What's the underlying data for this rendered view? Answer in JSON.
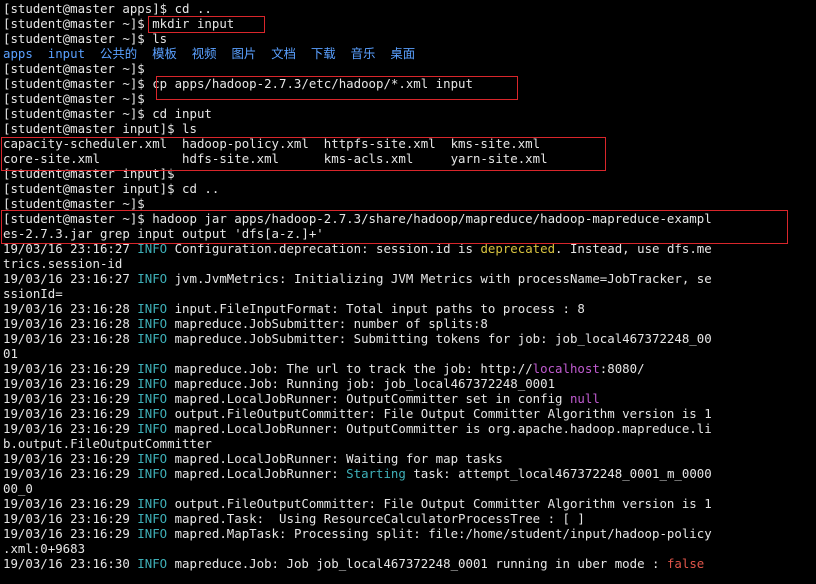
{
  "terminal": {
    "lines": [
      [
        [
          "[student@master apps]$ cd ..",
          ""
        ]
      ],
      [
        [
          "[student@master ~]$ mkdir input",
          ""
        ]
      ],
      [
        [
          "[student@master ~]$ ls",
          ""
        ]
      ],
      [
        [
          "apps",
          "blue"
        ],
        [
          "  ",
          ""
        ],
        [
          "input",
          "blue"
        ],
        [
          "  ",
          ""
        ],
        [
          "公共的",
          "blue"
        ],
        [
          "  ",
          ""
        ],
        [
          "模板",
          "blue"
        ],
        [
          "  ",
          ""
        ],
        [
          "视频",
          "blue"
        ],
        [
          "  ",
          ""
        ],
        [
          "图片",
          "blue"
        ],
        [
          "  ",
          ""
        ],
        [
          "文档",
          "blue"
        ],
        [
          "  ",
          ""
        ],
        [
          "下载",
          "blue"
        ],
        [
          "  ",
          ""
        ],
        [
          "音乐",
          "blue"
        ],
        [
          "  ",
          ""
        ],
        [
          "桌面",
          "blue"
        ]
      ],
      [
        [
          "[student@master ~]$",
          ""
        ]
      ],
      [
        [
          "[student@master ~]$ cp apps/hadoop-2.7.3/etc/hadoop/*.xml input",
          ""
        ]
      ],
      [
        [
          "[student@master ~]$",
          ""
        ]
      ],
      [
        [
          "[student@master ~]$ cd input",
          ""
        ]
      ],
      [
        [
          "[student@master input]$ ls",
          ""
        ]
      ],
      [
        [
          "capacity-scheduler.xml  hadoop-policy.xml  httpfs-site.xml  kms-site.xml",
          ""
        ]
      ],
      [
        [
          "core-site.xml           hdfs-site.xml      kms-acls.xml     yarn-site.xml",
          ""
        ]
      ],
      [
        [
          "[student@master input]$",
          ""
        ]
      ],
      [
        [
          "[student@master input]$ cd ..",
          ""
        ]
      ],
      [
        [
          "[student@master ~]$",
          ""
        ]
      ],
      [
        [
          "[student@master ~]$ hadoop jar apps/hadoop-2.7.3/share/hadoop/mapreduce/hadoop-mapreduce-exampl",
          ""
        ]
      ],
      [
        [
          "es-2.7.3.jar grep input output 'dfs[a-z.]+'",
          ""
        ]
      ],
      [
        [
          "19/03/16 23:16:27 ",
          ""
        ],
        [
          "INFO",
          "green"
        ],
        [
          " Configuration.deprecation: session.id is ",
          ""
        ],
        [
          "deprecated",
          "yellow"
        ],
        [
          ". Instead, use dfs.me",
          ""
        ]
      ],
      [
        [
          "trics.session-id",
          ""
        ]
      ],
      [
        [
          "19/03/16 23:16:27 ",
          ""
        ],
        [
          "INFO",
          "green"
        ],
        [
          " jvm.JvmMetrics: Initializing JVM Metrics with processName=JobTracker, se",
          ""
        ]
      ],
      [
        [
          "ssionId=",
          ""
        ]
      ],
      [
        [
          "19/03/16 23:16:28 ",
          ""
        ],
        [
          "INFO",
          "green"
        ],
        [
          " input.FileInputFormat: Total input paths to process : 8",
          ""
        ]
      ],
      [
        [
          "19/03/16 23:16:28 ",
          ""
        ],
        [
          "INFO",
          "green"
        ],
        [
          " mapreduce.JobSubmitter: number of splits:8",
          ""
        ]
      ],
      [
        [
          "19/03/16 23:16:28 ",
          ""
        ],
        [
          "INFO",
          "green"
        ],
        [
          " mapreduce.JobSubmitter: Submitting tokens for job: job_local467372248_00",
          ""
        ]
      ],
      [
        [
          "01",
          ""
        ]
      ],
      [
        [
          "19/03/16 23:16:29 ",
          ""
        ],
        [
          "INFO",
          "green"
        ],
        [
          " mapreduce.Job: The url to track the job: http://",
          ""
        ],
        [
          "localhost",
          "purple"
        ],
        [
          ":8080/",
          ""
        ]
      ],
      [
        [
          "19/03/16 23:16:29 ",
          ""
        ],
        [
          "INFO",
          "green"
        ],
        [
          " mapreduce.Job: Running job: job_local467372248_0001",
          ""
        ]
      ],
      [
        [
          "19/03/16 23:16:29 ",
          ""
        ],
        [
          "INFO",
          "green"
        ],
        [
          " mapred.LocalJobRunner: OutputCommitter set in config ",
          ""
        ],
        [
          "null",
          "purple"
        ]
      ],
      [
        [
          "19/03/16 23:16:29 ",
          ""
        ],
        [
          "INFO",
          "green"
        ],
        [
          " output.FileOutputCommitter: File Output Committer Algorithm version is 1",
          ""
        ]
      ],
      [
        [
          "19/03/16 23:16:29 ",
          ""
        ],
        [
          "INFO",
          "green"
        ],
        [
          " mapred.LocalJobRunner: OutputCommitter is org.apache.hadoop.mapreduce.li",
          ""
        ]
      ],
      [
        [
          "b.output.FileOutputCommitter",
          ""
        ]
      ],
      [
        [
          "19/03/16 23:16:29 ",
          ""
        ],
        [
          "INFO",
          "green"
        ],
        [
          " mapred.LocalJobRunner: Waiting for map tasks",
          ""
        ]
      ],
      [
        [
          "19/03/16 23:16:29 ",
          ""
        ],
        [
          "INFO",
          "green"
        ],
        [
          " mapred.LocalJobRunner: ",
          ""
        ],
        [
          "Starting",
          "green"
        ],
        [
          " task: attempt_local467372248_0001_m_0000",
          ""
        ]
      ],
      [
        [
          "00_0",
          ""
        ]
      ],
      [
        [
          "19/03/16 23:16:29 ",
          ""
        ],
        [
          "INFO",
          "green"
        ],
        [
          " output.FileOutputCommitter: File Output Committer Algorithm version is 1",
          ""
        ]
      ],
      [
        [
          "19/03/16 23:16:29 ",
          ""
        ],
        [
          "INFO",
          "green"
        ],
        [
          " mapred.Task:  Using ResourceCalculatorProcessTree : [ ]",
          ""
        ]
      ],
      [
        [
          "19/03/16 23:16:29 ",
          ""
        ],
        [
          "INFO",
          "green"
        ],
        [
          " mapred.MapTask: Processing split: file:/home/student/input/hadoop-policy",
          ""
        ]
      ],
      [
        [
          ".xml:0+9683",
          ""
        ]
      ],
      [
        [
          "19/03/16 23:16:30 ",
          ""
        ],
        [
          "INFO",
          "green"
        ],
        [
          " mapreduce.Job: Job job_local467372248_0001 running in uber mode : ",
          ""
        ],
        [
          "false",
          "red"
        ]
      ]
    ]
  }
}
